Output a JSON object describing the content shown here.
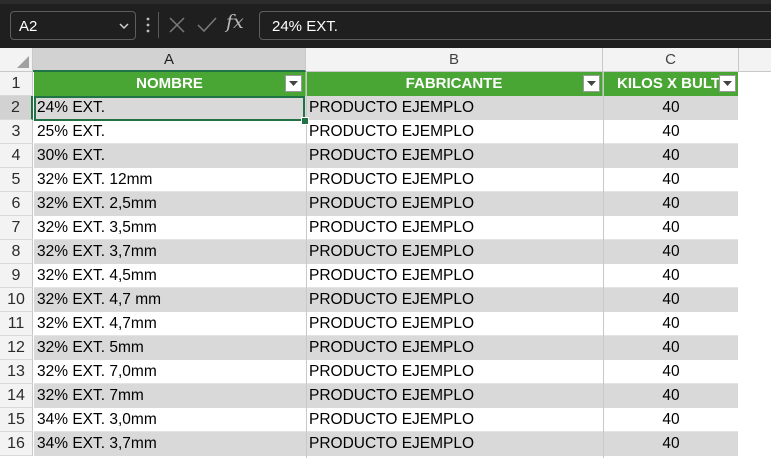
{
  "formula_bar": {
    "name_box": "A2",
    "formula": "24% EXT.",
    "fx_label": "fx"
  },
  "columns": [
    {
      "letter": "A",
      "header": "NOMBRE"
    },
    {
      "letter": "B",
      "header": "FABRICANTE"
    },
    {
      "letter": "C",
      "header": "KILOS X BULTO"
    }
  ],
  "header_row_number": "1",
  "rows": [
    {
      "num": "2",
      "nombre": "24% EXT.",
      "fabricante": "PRODUCTO EJEMPLO",
      "kilos": "40"
    },
    {
      "num": "3",
      "nombre": "25% EXT.",
      "fabricante": "PRODUCTO EJEMPLO",
      "kilos": "40"
    },
    {
      "num": "4",
      "nombre": "30% EXT.",
      "fabricante": "PRODUCTO EJEMPLO",
      "kilos": "40"
    },
    {
      "num": "5",
      "nombre": "32% EXT. 12mm",
      "fabricante": "PRODUCTO EJEMPLO",
      "kilos": "40"
    },
    {
      "num": "6",
      "nombre": "32% EXT. 2,5mm",
      "fabricante": "PRODUCTO EJEMPLO",
      "kilos": "40"
    },
    {
      "num": "7",
      "nombre": "32% EXT. 3,5mm",
      "fabricante": "PRODUCTO EJEMPLO",
      "kilos": "40"
    },
    {
      "num": "8",
      "nombre": "32% EXT. 3,7mm",
      "fabricante": "PRODUCTO EJEMPLO",
      "kilos": "40"
    },
    {
      "num": "9",
      "nombre": "32% EXT. 4,5mm",
      "fabricante": "PRODUCTO EJEMPLO",
      "kilos": "40"
    },
    {
      "num": "10",
      "nombre": "32% EXT. 4,7 mm",
      "fabricante": "PRODUCTO EJEMPLO",
      "kilos": "40"
    },
    {
      "num": "11",
      "nombre": "32% EXT. 4,7mm",
      "fabricante": "PRODUCTO EJEMPLO",
      "kilos": "40"
    },
    {
      "num": "12",
      "nombre": "32% EXT. 5mm",
      "fabricante": "PRODUCTO EJEMPLO",
      "kilos": "40"
    },
    {
      "num": "13",
      "nombre": "32% EXT. 7,0mm",
      "fabricante": "PRODUCTO EJEMPLO",
      "kilos": "40"
    },
    {
      "num": "14",
      "nombre": "32% EXT. 7mm",
      "fabricante": "PRODUCTO EJEMPLO",
      "kilos": "40"
    },
    {
      "num": "15",
      "nombre": "34% EXT. 3,0mm",
      "fabricante": "PRODUCTO EJEMPLO",
      "kilos": "40"
    },
    {
      "num": "16",
      "nombre": "34% EXT. 3,7mm",
      "fabricante": "PRODUCTO EJEMPLO",
      "kilos": "40"
    }
  ],
  "colors": {
    "header_green": "#4aa634",
    "band_gray": "#d9d9d9",
    "selection_green": "#217346"
  }
}
